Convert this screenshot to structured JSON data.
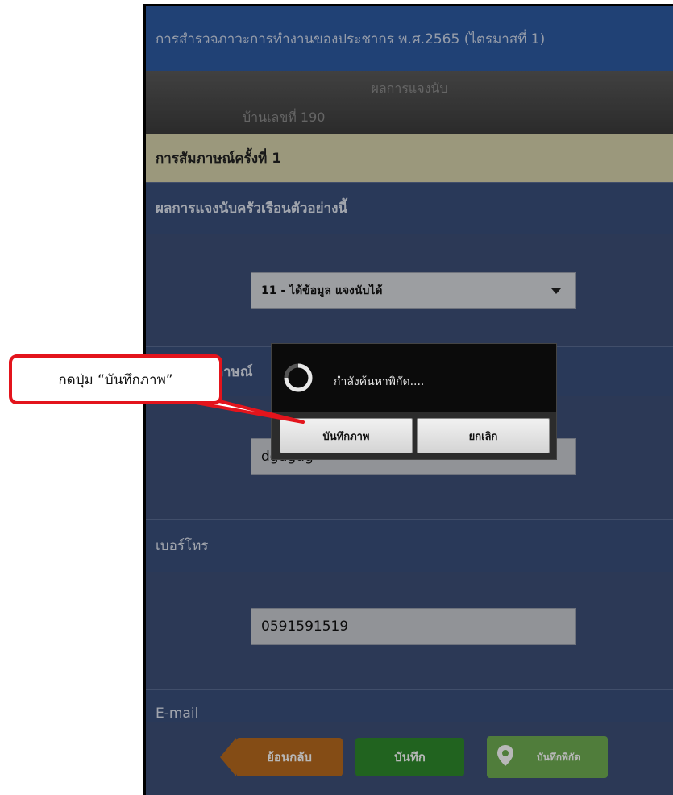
{
  "app": {
    "title": "การสำรวจภาวะการทำงานของประชากร พ.ศ.2565 (ไตรมาสที่ 1)"
  },
  "info": {
    "line1": "ผลการแจงนับ",
    "line2": "บ้านเลขที่ 190"
  },
  "interview": {
    "label": "การสัมภาษณ์ครั้งที่ 1"
  },
  "sections": {
    "result": {
      "header": "ผลการแจงนับครัวเรือนตัวอย่างนี้",
      "value": "11 - ได้ข้อมูล แจงนับได้"
    },
    "respondent": {
      "header_partial": "ชื่อผู้ให้สัมภาษณ์",
      "value": "dgdgdg"
    },
    "phone": {
      "header": "เบอร์โทร",
      "value": "0591591519"
    },
    "email": {
      "header": "E-mail"
    }
  },
  "footer": {
    "back": "ย้อนกลับ",
    "save": "บันทึก",
    "save_geo": "บันทึกพิกัด"
  },
  "dialog": {
    "message": "กำลังค้นหาพิกัด....",
    "save_photo": "บันทึกภาพ",
    "cancel": "ยกเลิก"
  },
  "callout": {
    "text": "กดปุ่ม “บันทึกภาพ”"
  },
  "colors": {
    "appbar": "#2d5aa3",
    "section": "#3a4f7c",
    "interview": "#d7d3ac",
    "back": "#b86a1e",
    "save": "#2e8a2c",
    "geo": "#6fae52",
    "callout_border": "#e3141c"
  },
  "icons": {
    "dropdown": "caret-down-icon",
    "location": "map-pin-icon",
    "loading": "spinner-icon"
  }
}
